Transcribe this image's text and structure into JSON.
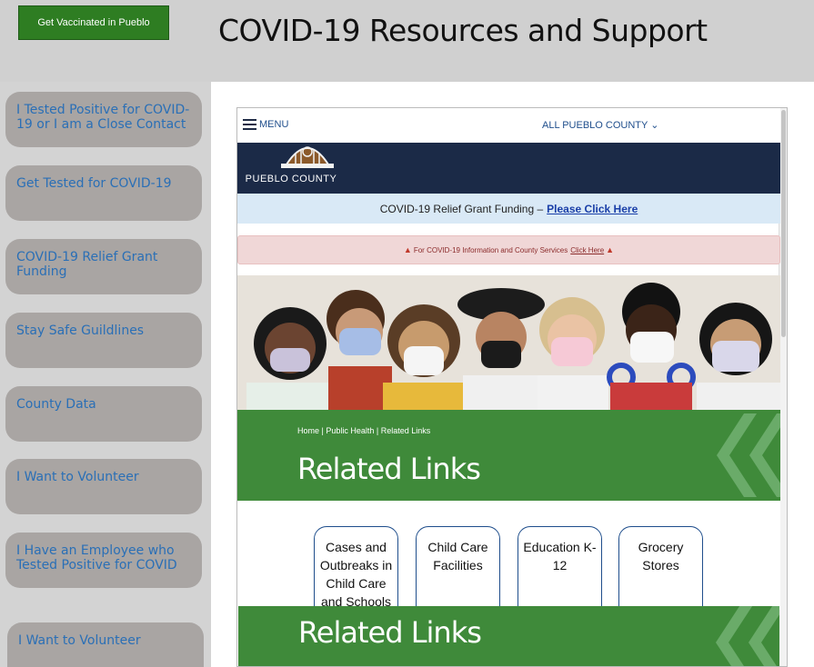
{
  "header": {
    "vaccinate_button": "Get Vaccinated in Pueblo",
    "title": "COVID-19 Resources and Support"
  },
  "sidebar": {
    "items": [
      {
        "label": "I Tested Positive for COVID-19 or I am a Close Contact"
      },
      {
        "label": "Get Tested for COVID-19"
      },
      {
        "label": "COVID-19 Relief Grant Funding"
      },
      {
        "label": "Stay Safe Guildlines"
      },
      {
        "label": "County Data"
      },
      {
        "label": "I Want to Volunteer"
      },
      {
        "label": "I Have an Employee who Tested Positive for COVID"
      }
    ],
    "overlay_item": "I Want to Volunteer"
  },
  "embedded_site": {
    "menu_label": "MENU",
    "county_select": "ALL PUEBLO COUNTY",
    "logo_text": "PUEBLO COUNTY",
    "relief_bar": {
      "text": "COVID-19 Relief Grant Funding –",
      "link": "Please Click Here"
    },
    "alert_bar": {
      "text": "For COVID-19 Information and County Services",
      "link": "Click Here"
    },
    "breadcrumb": [
      "Home",
      "Public Health",
      "Related Links"
    ],
    "page_heading": "Related Links",
    "cards": [
      {
        "label": "Cases and Outbreaks in Child Care and Schools"
      },
      {
        "label": "Child Care Facilities"
      },
      {
        "label": "Education K-12"
      },
      {
        "label": "Grocery Stores"
      }
    ],
    "overlay_heading": "Related Links"
  },
  "colors": {
    "vaccinate_green": "#2e7d22",
    "sidebar_button": "#a9a5a3",
    "sidebar_text": "#2a6fb6",
    "county_navy": "#1b2a47",
    "band_green": "#3f8a3a"
  }
}
